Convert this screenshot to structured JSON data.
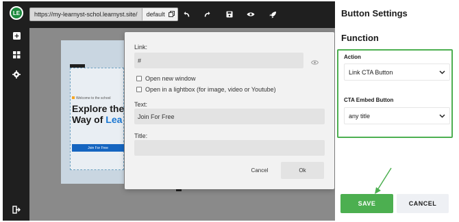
{
  "toolbar": {
    "url": "https://my-learnyst-schol.learnyst.site/",
    "site_select": "default"
  },
  "sidebar": {
    "logo_text": "LE",
    "icons": [
      "add-icon",
      "widgets-icon",
      "settings-icon",
      "logout-icon"
    ]
  },
  "preview": {
    "welcome": "Welcome to the school",
    "heading_line1": "Explore the",
    "heading_line2_a": "Way of ",
    "heading_line2_b": "Lea",
    "cta_label": "Join For Free"
  },
  "link_dialog": {
    "link_label": "Link:",
    "link_value": "#",
    "open_new_window": "Open new window",
    "open_lightbox": "Open in a lightbox (for image, video or Youtube)",
    "text_label": "Text:",
    "text_value": "Join For Free",
    "title_label": "Title:",
    "title_value": "",
    "cancel_label": "Cancel",
    "ok_label": "Ok"
  },
  "panel": {
    "title": "Button Settings",
    "section": "Function",
    "action_label": "Action",
    "action_value": "Link CTA Button",
    "embed_label": "CTA Embed Button",
    "embed_value": "any title",
    "save_label": "SAVE",
    "cancel_label": "CANCEL"
  },
  "colors": {
    "accent_green": "#4caf50",
    "dark_chrome": "#1f1f1f",
    "preview_blue": "#1565c0"
  }
}
